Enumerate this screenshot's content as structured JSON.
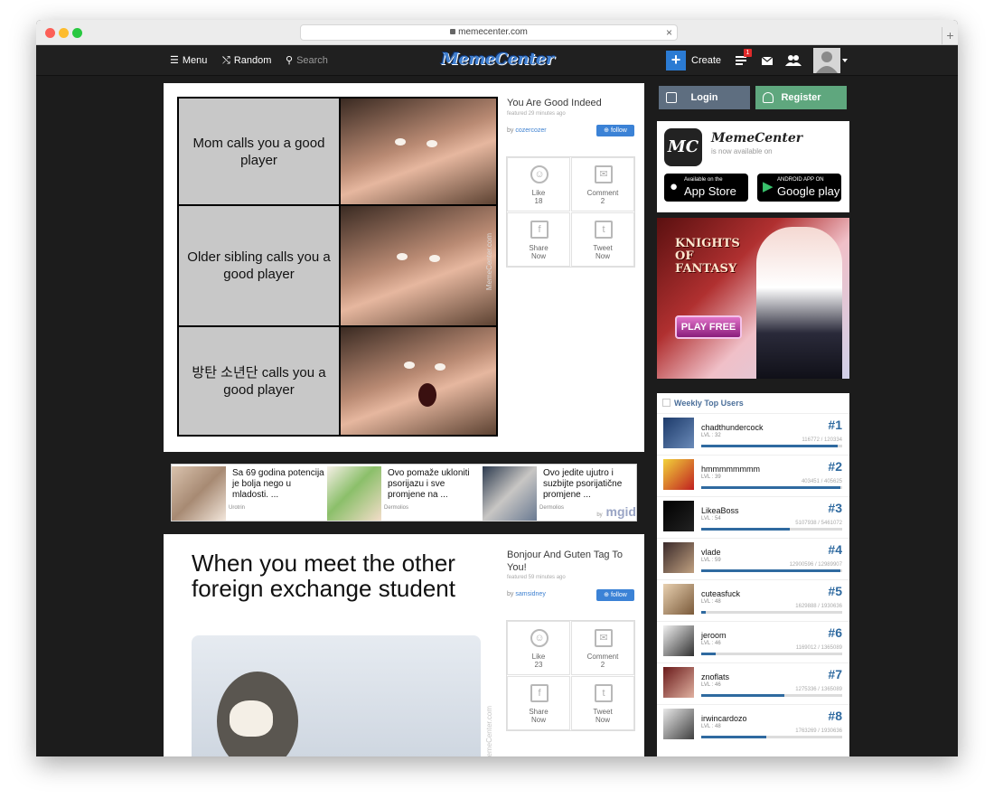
{
  "browser": {
    "url": "memecenter.com"
  },
  "nav": {
    "menu_label": "Menu",
    "random_label": "Random",
    "search_label": "Search",
    "logo_text": "MemeCenter",
    "create_label": "Create",
    "notification_count": "1"
  },
  "auth": {
    "login_label": "Login",
    "register_label": "Register"
  },
  "post1": {
    "title": "You Are Good Indeed",
    "featured": "featured 29 minutes ago",
    "by_prefix": "by",
    "author": "cozercozer",
    "follow_label": "follow",
    "meme_panels": [
      "Mom calls you a good player",
      "Older sibling calls you a good player",
      "방탄 소년단 calls you a good player"
    ],
    "watermark": "MemeCenter.com",
    "actions": [
      {
        "label": "Like",
        "value": "18"
      },
      {
        "label": "Comment",
        "value": "2"
      },
      {
        "label": "Share",
        "value": "Now"
      },
      {
        "label": "Tweet",
        "value": "Now"
      }
    ]
  },
  "ads": {
    "items": [
      {
        "title": "Sa 69 godina potencija je bolja nego u mladosti. ...",
        "source": "Urotrin"
      },
      {
        "title": "Ovo pomaže ukloniti psorijazu i sve promjene na ...",
        "source": "Dermolios"
      },
      {
        "title": "Ovo jedite ujutro i suzbijte psorijatične promjene ...",
        "source": "Dermolios"
      }
    ],
    "brand_by": "by",
    "brand": "mgid"
  },
  "post2": {
    "title": "Bonjour And Guten Tag To You!",
    "featured": "featured 59 minutes ago",
    "by_prefix": "by",
    "author": "samsidney",
    "follow_label": "follow",
    "meme_text": "When you meet the other foreign exchange student",
    "watermark": "MemeCenter.com",
    "actions": [
      {
        "label": "Like",
        "value": "23"
      },
      {
        "label": "Comment",
        "value": "2"
      },
      {
        "label": "Share",
        "value": "Now"
      },
      {
        "label": "Tweet",
        "value": "Now"
      }
    ]
  },
  "app_promo": {
    "logo_letters": "MC",
    "name": "MemeCenter",
    "subtitle": "is now available on",
    "appstore_small": "Available on the",
    "appstore_big": "App Store",
    "gplay_small": "ANDROID APP ON",
    "gplay_big": "Google play"
  },
  "banner": {
    "title": "KNIGHTS OF FANTASY",
    "cta": "PLAY FREE"
  },
  "top_users": {
    "heading": "Weekly Top Users",
    "users": [
      {
        "name": "chadthundercock",
        "level": "LVL : 32",
        "points": "116772 / 120334",
        "rank": "#1",
        "progress": 0.97
      },
      {
        "name": "hmmmmmmmm",
        "level": "LVL : 39",
        "points": "403451 / 405625",
        "rank": "#2",
        "progress": 0.99
      },
      {
        "name": "LikeaBoss",
        "level": "LVL : 54",
        "points": "5107938 / 5461072",
        "rank": "#3",
        "progress": 0.63
      },
      {
        "name": "vlade",
        "level": "LVL : 59",
        "points": "12900596 / 12989907",
        "rank": "#4",
        "progress": 0.99
      },
      {
        "name": "cuteasfuck",
        "level": "LVL : 48",
        "points": "1629888 / 1930636",
        "rank": "#5",
        "progress": 0.03
      },
      {
        "name": "jeroom",
        "level": "LVL : 46",
        "points": "1169012 / 1365089",
        "rank": "#6",
        "progress": 0.1
      },
      {
        "name": "znoflats",
        "level": "LVL : 46",
        "points": "1275336 / 1365089",
        "rank": "#7",
        "progress": 0.59
      },
      {
        "name": "irwincardozo",
        "level": "LVL : 48",
        "points": "1763269 / 1930636",
        "rank": "#8",
        "progress": 0.46
      }
    ]
  },
  "colors": {
    "accent": "#2f6aa0",
    "register": "#5fa77e",
    "login": "#5e6e80",
    "create": "#2b7bd3"
  }
}
